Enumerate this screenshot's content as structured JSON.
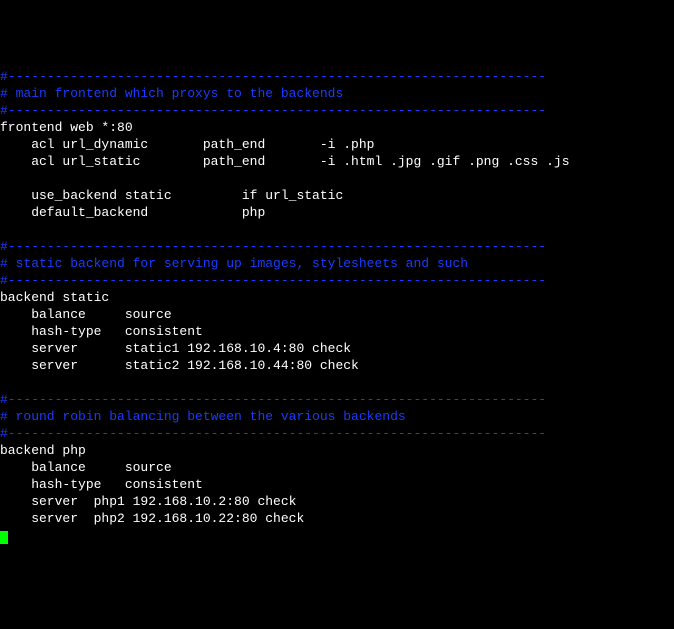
{
  "lines": [
    {
      "cls": "comment",
      "text": "#---------------------------------------------------------------------"
    },
    {
      "cls": "comment",
      "text": "# main frontend which proxys to the backends"
    },
    {
      "cls": "comment",
      "text": "#---------------------------------------------------------------------"
    },
    {
      "cls": "text",
      "text": "frontend web *:80"
    },
    {
      "cls": "text",
      "text": "    acl url_dynamic       path_end       -i .php"
    },
    {
      "cls": "text",
      "text": "    acl url_static        path_end       -i .html .jpg .gif .png .css .js"
    },
    {
      "cls": "text",
      "text": ""
    },
    {
      "cls": "text",
      "text": "    use_backend static         if url_static"
    },
    {
      "cls": "text",
      "text": "    default_backend            php"
    },
    {
      "cls": "text",
      "text": ""
    },
    {
      "cls": "comment",
      "text": "#---------------------------------------------------------------------"
    },
    {
      "cls": "comment",
      "text": "# static backend for serving up images, stylesheets and such"
    },
    {
      "cls": "comment",
      "text": "#---------------------------------------------------------------------"
    },
    {
      "cls": "text",
      "text": "backend static"
    },
    {
      "cls": "text",
      "text": "    balance     source"
    },
    {
      "cls": "text",
      "text": "    hash-type   consistent"
    },
    {
      "cls": "text",
      "text": "    server      static1 192.168.10.4:80 check"
    },
    {
      "cls": "text",
      "text": "    server      static2 192.168.10.44:80 check"
    },
    {
      "cls": "text",
      "text": ""
    },
    {
      "cls": "comment",
      "text": "#---------------------------------------------------------------------"
    },
    {
      "cls": "comment",
      "text": "# round robin balancing between the various backends"
    },
    {
      "cls": "comment",
      "text": "#---------------------------------------------------------------------"
    },
    {
      "cls": "text",
      "text": "backend php"
    },
    {
      "cls": "text",
      "text": "    balance     source"
    },
    {
      "cls": "text",
      "text": "    hash-type   consistent"
    },
    {
      "cls": "text",
      "text": "    server  php1 192.168.10.2:80 check"
    },
    {
      "cls": "text",
      "text": "    server  php2 192.168.10.22:80 check"
    }
  ]
}
